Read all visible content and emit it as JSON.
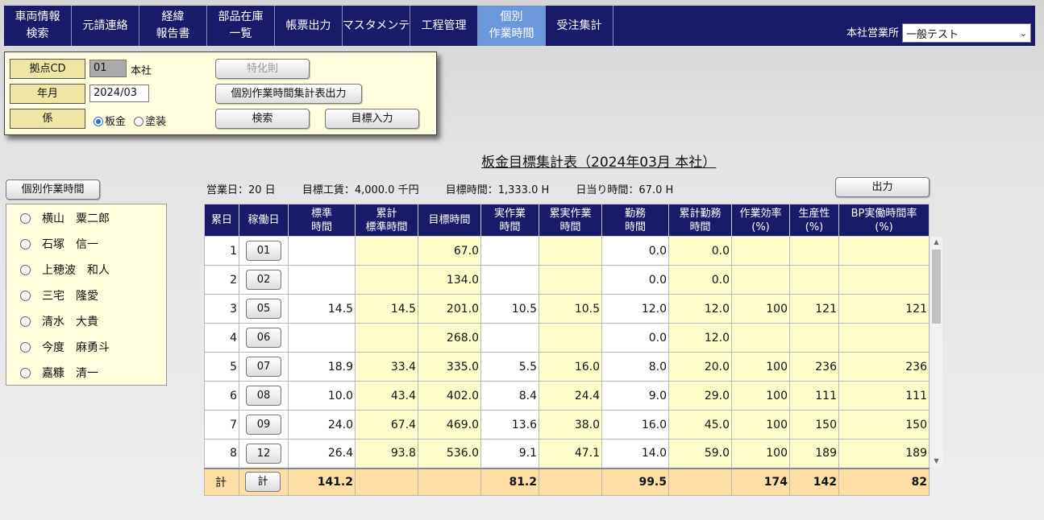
{
  "nav": {
    "items": [
      {
        "line1": "車両情報",
        "line2": "検索",
        "width": 84
      },
      {
        "line1": "元請連絡",
        "line2": "",
        "width": 84
      },
      {
        "line1": "経緯",
        "line2": "報告書",
        "width": 84
      },
      {
        "line1": "部品在庫",
        "line2": "一覧",
        "width": 84
      },
      {
        "line1": "帳票出力",
        "line2": "",
        "width": 84
      },
      {
        "line1": "マスタメンテ",
        "line2": "",
        "width": 84
      },
      {
        "line1": "工程管理",
        "line2": "",
        "width": 84
      },
      {
        "line1": "個別",
        "line2": "作業時間",
        "width": 84
      },
      {
        "line1": "受注集計",
        "line2": "",
        "width": 84
      }
    ],
    "office_label": "本社営業所",
    "office_select": "一般テスト"
  },
  "filter": {
    "base_cd_label": "拠点CD",
    "base_cd_value": "01",
    "base_name": "本社",
    "yearmonth_label": "年月",
    "yearmonth_value": "2024/03",
    "section_label": "係",
    "radio_sheet": "板金",
    "radio_paint": "塗装",
    "btn_special": "特化則",
    "btn_export": "個別作業時間集計表出力",
    "btn_search": "検索",
    "btn_target": "目標入力"
  },
  "report_title": "板金目標集計表（2024年03月 本社）",
  "summary": {
    "business_days": "営業日：20 日",
    "target_wage": "目標工賃：4,000.0 千円",
    "target_hours": "目標時間：1,333.0 H",
    "daily_hours": "日当り時間：67.0 H"
  },
  "btn_output": "出力",
  "btn_individual": "個別作業時間",
  "employees": [
    "横山　粟二郎",
    "石塚　信一",
    "上穂波　和人",
    "三宅　隆愛",
    "清水　大貴",
    "今度　麻勇斗",
    "嘉糠　清一"
  ],
  "table": {
    "headers": [
      {
        "l1": "累日",
        "l2": ""
      },
      {
        "l1": "稼働日",
        "l2": ""
      },
      {
        "l1": "標準",
        "l2": "時間"
      },
      {
        "l1": "累計",
        "l2": "標準時間"
      },
      {
        "l1": "目標時間",
        "l2": ""
      },
      {
        "l1": "実作業",
        "l2": "時間"
      },
      {
        "l1": "累実作業",
        "l2": "時間"
      },
      {
        "l1": "勤務",
        "l2": "時間"
      },
      {
        "l1": "累計勤務",
        "l2": "時間"
      },
      {
        "l1": "作業効率",
        "l2": "(%)"
      },
      {
        "l1": "生産性",
        "l2": "(%)"
      },
      {
        "l1": "BP実働時間率",
        "l2": "(%)"
      }
    ],
    "rows": [
      [
        "1",
        "01",
        "",
        "",
        "67.0",
        "",
        "",
        "0.0",
        "0.0",
        "",
        "",
        ""
      ],
      [
        "2",
        "02",
        "",
        "",
        "134.0",
        "",
        "",
        "0.0",
        "0.0",
        "",
        "",
        ""
      ],
      [
        "3",
        "05",
        "14.5",
        "14.5",
        "201.0",
        "10.5",
        "10.5",
        "12.0",
        "12.0",
        "100",
        "121",
        "121"
      ],
      [
        "4",
        "06",
        "",
        "",
        "268.0",
        "",
        "",
        "0.0",
        "12.0",
        "",
        "",
        ""
      ],
      [
        "5",
        "07",
        "18.9",
        "33.4",
        "335.0",
        "5.5",
        "16.0",
        "8.0",
        "20.0",
        "100",
        "236",
        "236"
      ],
      [
        "6",
        "08",
        "10.0",
        "43.4",
        "402.0",
        "8.4",
        "24.4",
        "9.0",
        "29.0",
        "100",
        "111",
        "111"
      ],
      [
        "7",
        "09",
        "24.0",
        "67.4",
        "469.0",
        "13.6",
        "38.0",
        "16.0",
        "45.0",
        "100",
        "150",
        "150"
      ],
      [
        "8",
        "12",
        "26.4",
        "93.8",
        "536.0",
        "9.1",
        "47.1",
        "14.0",
        "59.0",
        "100",
        "189",
        "189"
      ]
    ],
    "total": [
      "計",
      "計",
      "141.2",
      "",
      "",
      "81.2",
      "",
      "99.5",
      "",
      "174",
      "142",
      "82"
    ]
  },
  "colors": {
    "nav_bg": "#1a1a6b",
    "nav_active": "#6b97dc",
    "panel_bg": "#ffffe0",
    "cell_yellow": "#ffffcc",
    "total_bg": "#ffdea5"
  }
}
